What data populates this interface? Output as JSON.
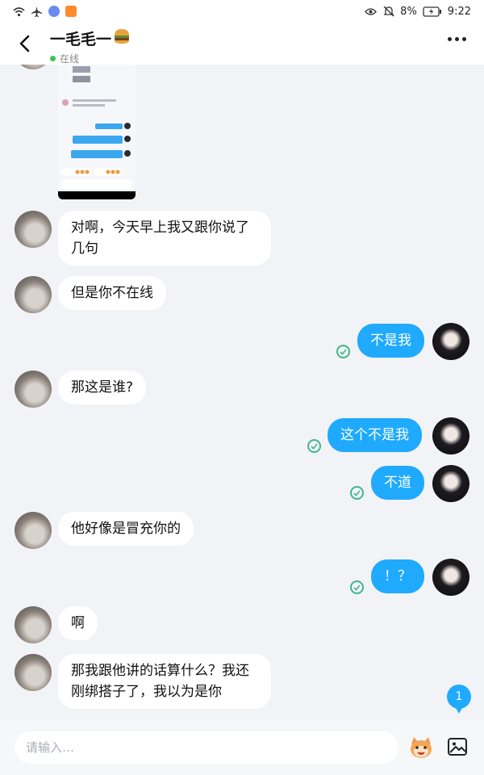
{
  "status_bar": {
    "battery": "8%",
    "time": "9:22"
  },
  "header": {
    "title": "一毛毛一",
    "status": "在线"
  },
  "messages": [
    {
      "side": "left",
      "text": "对啊，今天早上我又跟你说了\n几句"
    },
    {
      "side": "left",
      "text": "但是你不在线"
    },
    {
      "side": "right",
      "text": "不是我"
    },
    {
      "side": "left",
      "text": "那这是谁?"
    },
    {
      "side": "right",
      "text": "这个不是我"
    },
    {
      "side": "right",
      "text": "不道"
    },
    {
      "side": "left",
      "text": "他好像是冒充你的"
    },
    {
      "side": "right",
      "text": "！？"
    },
    {
      "side": "left",
      "text": "啊"
    },
    {
      "side": "left",
      "text": "那我跟他讲的话算什么？我还\n刚绑搭子了，我以为是你"
    }
  ],
  "unread_count": "1",
  "input": {
    "placeholder": "请输入…"
  },
  "colors": {
    "accent": "#1faafe",
    "read_check": "#3fb68b",
    "online": "#3ec254"
  },
  "icons": [
    "wifi-icon",
    "airplane-icon",
    "music-app-icon",
    "video-app-icon",
    "eye-icon",
    "mute-bell-icon",
    "battery-icon",
    "back-arrow-icon",
    "burger-emoji-icon",
    "more-dots-icon",
    "read-check-icon",
    "emoji-face-icon",
    "image-icon"
  ]
}
